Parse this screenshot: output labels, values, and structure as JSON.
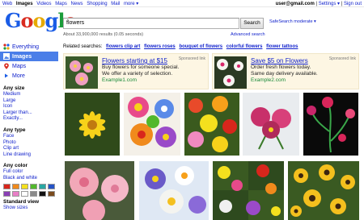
{
  "topnav": [
    "Web",
    "Images",
    "Videos",
    "Maps",
    "News",
    "Shopping",
    "Mail",
    "more ▾"
  ],
  "user": {
    "email": "user@gmail.com",
    "sep1": " | ",
    "settings": "Settings ▾",
    "sep2": " | ",
    "signout": "Sign out"
  },
  "logo": {
    "G": "G",
    "o1": "o",
    "o2": "o",
    "g": "g",
    "l": "l",
    "e": "e"
  },
  "search": {
    "query": "flowers",
    "button": "Search",
    "safesearch": "SafeSearch moderate ▾",
    "stats": "About 33,900,000 results (0.05 seconds)",
    "advanced": "Advanced search"
  },
  "sidebar": {
    "nav": [
      {
        "label": "Everything",
        "icon": "everything-icon"
      },
      {
        "label": "Images",
        "icon": "images-icon"
      },
      {
        "label": "Maps",
        "icon": "maps-icon"
      },
      {
        "label": "More",
        "icon": "more-icon"
      }
    ],
    "size_title": "Any size",
    "sizes": [
      "Medium",
      "Large",
      "Icon",
      "Larger than...",
      "Exactly..."
    ],
    "type_title": "Any type",
    "types": [
      "Face",
      "Photo",
      "Clip art",
      "Line drawing"
    ],
    "color_title": "Any color",
    "colors": [
      "Full color",
      "Black and white"
    ],
    "swatches": [
      "#d8261c",
      "#f08a1c",
      "#f4e01e",
      "#52b82c",
      "#2aa7a3",
      "#2553c6",
      "#8a3fb5",
      "#e87fc6",
      "#ffffff",
      "#8a8a8a",
      "#111111",
      "#7a4b1e"
    ],
    "view_title": "Standard view",
    "view_opt": "Show sizes"
  },
  "related": {
    "label": "Related searches:",
    "items": [
      "flowers clip art",
      "flowers roses",
      "bouquet of flowers",
      "colorful flowers",
      "flower tattoos"
    ]
  },
  "ads": [
    {
      "title": "Flowers starting at $15",
      "line1": "Buy flowers for someone special.",
      "line2": "We offer a variety of selection.",
      "url": "Example1.com",
      "sponsored": "Sponsored link"
    },
    {
      "title": "Save $5 on Flowers",
      "line1": "Order fresh flowers today.",
      "line2": "Same day delivery available.",
      "url": "Example2.com",
      "sponsored": "Sponsored link"
    }
  ]
}
